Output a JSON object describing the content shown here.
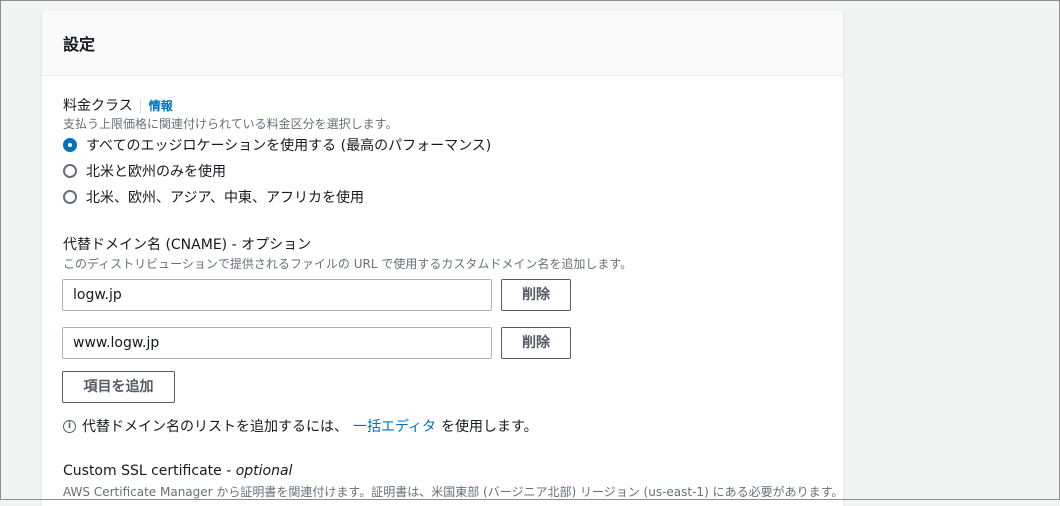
{
  "panel": {
    "title": "設定"
  },
  "price_class": {
    "label": "料金クラス",
    "info_link": "情報",
    "description": "支払う上限価格に関連付けられている料金区分を選択します。",
    "options": [
      {
        "label": "すべてのエッジロケーションを使用する (最高のパフォーマンス)",
        "selected": true
      },
      {
        "label": "北米と欧州のみを使用",
        "selected": false
      },
      {
        "label": "北米、欧州、アジア、中東、アフリカを使用",
        "selected": false
      }
    ]
  },
  "cname": {
    "label": "代替ドメイン名 (CNAME) - オプション",
    "description": "このディストリビューションで提供されるファイルの URL で使用するカスタムドメイン名を追加します。",
    "items": [
      {
        "value": "logw.jp",
        "remove_label": "削除"
      },
      {
        "value": "www.logw.jp",
        "remove_label": "削除"
      }
    ],
    "add_label": "項目を追加",
    "info_icon": "info-icon",
    "info_text_before": "代替ドメイン名のリストを追加するには、",
    "info_link": "一括エディタ",
    "info_text_after": "を使用します。"
  },
  "ssl": {
    "label": "Custom SSL certificate - ",
    "label_optional": "optional",
    "description": "AWS Certificate Manager から証明書を関連付けます。証明書は、米国東部 (バージニア北部) リージョン (us-east-1) にある必要があります。"
  },
  "colors": {
    "accent": "#0073bb",
    "text": "#16191f",
    "muted": "#687078"
  }
}
